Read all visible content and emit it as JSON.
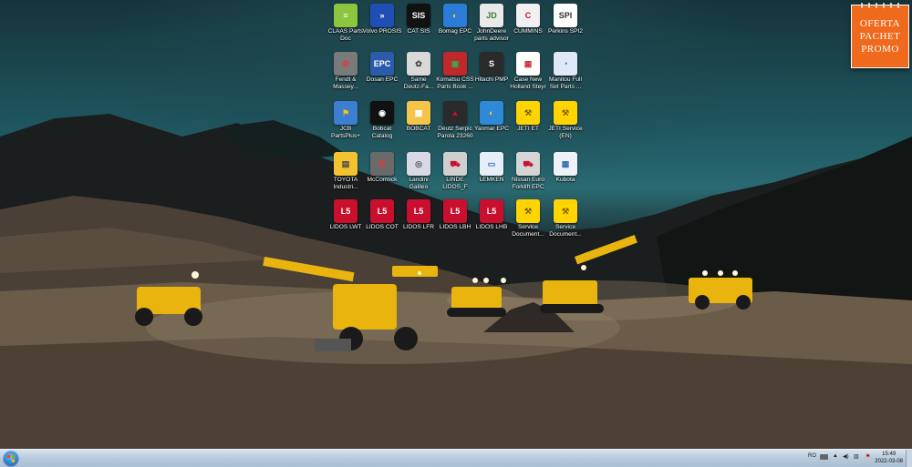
{
  "desktop": {
    "icons": [
      {
        "label": "CLAAS Parts\nDoc",
        "glyph": "≡",
        "bg": "#8cc63f",
        "fg": "#fff"
      },
      {
        "label": "Volvo PROSIS",
        "glyph": "»",
        "bg": "#1f4fb4",
        "fg": "#fff"
      },
      {
        "label": "CAT SIS",
        "glyph": "SIS",
        "bg": "#111111",
        "fg": "#fff"
      },
      {
        "label": "Bomag EPC",
        "glyph": "◐",
        "bg": "#2b7bd8",
        "fg": "#ffd200"
      },
      {
        "label": "JohnDeere\nparts advisor",
        "glyph": "JD",
        "bg": "#e9e9e9",
        "fg": "#367c2b"
      },
      {
        "label": "CUMMINS",
        "glyph": "C",
        "bg": "#f0f0f0",
        "fg": "#c8102e"
      },
      {
        "label": "Perkins SPI2",
        "glyph": "SPI",
        "bg": "#ffffff",
        "fg": "#333"
      },
      {
        "label": "Fendt &\nMassey...",
        "glyph": "⚙",
        "bg": "#7a7a7a",
        "fg": "#e33"
      },
      {
        "label": "Dosan EPC",
        "glyph": "EPC",
        "bg": "#2a5caa",
        "fg": "#fff"
      },
      {
        "label": "Same\nDeutz-Fa...",
        "glyph": "✿",
        "bg": "#d9d9d9",
        "fg": "#444"
      },
      {
        "label": "Komatsu CSS\nParts Book ...",
        "glyph": "▣",
        "bg": "#c0282b",
        "fg": "#2fae4a"
      },
      {
        "label": "Hitachi PMP",
        "glyph": "S",
        "bg": "#2a2a2a",
        "fg": "#fff"
      },
      {
        "label": "Case New\nHolland Steyr",
        "glyph": "▦",
        "bg": "#ffffff",
        "fg": "#c33"
      },
      {
        "label": "Manitou Full\nSet Parts ...",
        "glyph": "◔",
        "bg": "#dfe8f7",
        "fg": "#2a5caa"
      },
      {
        "label": "JCB\nPartsPlus+",
        "glyph": "⚑",
        "bg": "#3c7fd0",
        "fg": "#ffc20e"
      },
      {
        "label": "Bobcat\nCatalog",
        "glyph": "◉",
        "bg": "#111111",
        "fg": "#fff"
      },
      {
        "label": "BOBCAT",
        "glyph": "▦",
        "bg": "#f5c44a",
        "fg": "#fff"
      },
      {
        "label": "Deutz Serpic\nParola 23260",
        "glyph": "▲",
        "bg": "#2b2b2b",
        "fg": "#c8102e"
      },
      {
        "label": "Yanmar EPC",
        "glyph": "◐",
        "bg": "#2e8ad8",
        "fg": "#ffd200"
      },
      {
        "label": "JETI ET",
        "glyph": "⚒",
        "bg": "#ffd400",
        "fg": "#7a5a00"
      },
      {
        "label": "JETI Service\n(EN)",
        "glyph": "⚒",
        "bg": "#ffd400",
        "fg": "#7a5a00"
      },
      {
        "label": "TOYOTA\nIndustri...",
        "glyph": "▤",
        "bg": "#f2c230",
        "fg": "#444"
      },
      {
        "label": "McCormick",
        "glyph": "⚙",
        "bg": "#6a6a6a",
        "fg": "#e33"
      },
      {
        "label": "Landini\nGalileo",
        "glyph": "◎",
        "bg": "#d9d9e6",
        "fg": "#555"
      },
      {
        "label": "LINDE\nLIDOS_F",
        "glyph": "⛟",
        "bg": "#cfcfcf",
        "fg": "#c8102e"
      },
      {
        "label": "LEMKEN",
        "glyph": "▭",
        "bg": "#e8eef7",
        "fg": "#1e6fd0"
      },
      {
        "label": "Nissan Euro\nForklift EPC",
        "glyph": "⛟",
        "bg": "#d5d5d5",
        "fg": "#c8102e"
      },
      {
        "label": "Kubota",
        "glyph": "▦",
        "bg": "#eef2f6",
        "fg": "#2f6db5"
      },
      {
        "label": "LIDOS LWT",
        "glyph": "L5",
        "bg": "#c8102e",
        "fg": "#fff"
      },
      {
        "label": "LIDOS COT",
        "glyph": "L5",
        "bg": "#c8102e",
        "fg": "#fff"
      },
      {
        "label": "LIDOS LFR",
        "glyph": "L5",
        "bg": "#c8102e",
        "fg": "#fff"
      },
      {
        "label": "LIDOS LBH",
        "glyph": "L5",
        "bg": "#c8102e",
        "fg": "#fff"
      },
      {
        "label": "LIDOS LHB",
        "glyph": "L5",
        "bg": "#c8102e",
        "fg": "#fff"
      },
      {
        "label": "Service\nDocument...",
        "glyph": "⚒",
        "bg": "#ffd400",
        "fg": "#7a5a00"
      },
      {
        "label": "Service\nDocument...",
        "glyph": "⚒",
        "bg": "#ffd400",
        "fg": "#7a5a00"
      }
    ]
  },
  "promo": {
    "line1": "OFERTA",
    "line2": "PACHET",
    "line3": "PROMO"
  },
  "taskbar": {
    "language": "RO",
    "clock_time": "15:49",
    "clock_date": "2022-03-08"
  }
}
